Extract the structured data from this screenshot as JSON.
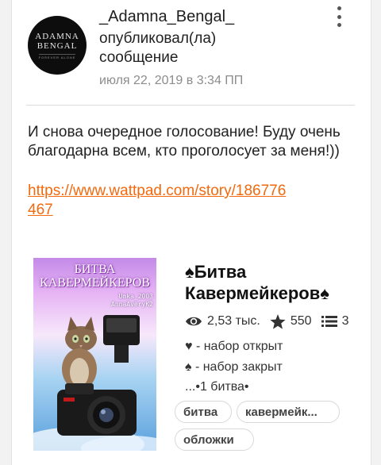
{
  "post": {
    "author": "_Adamna_Bengal_",
    "action": "опубликовал(ла) сообщение",
    "timestamp": "июля 22, 2019 в 3:34 ПП",
    "avatar": {
      "line1": "ADAMNA",
      "line2": "BENGAL",
      "line3": "FOREVER ALONE"
    },
    "menu_icon": "more-vertical-icon",
    "message": "И снова очередное голосование! Буду очень благодарна всем, кто проголосует за меня!))",
    "link": "https://www.wattpad.com/story/186776467"
  },
  "story": {
    "title": "♠Битва Кавермейкеров♠",
    "cover": {
      "title_line1": "БИТВА",
      "title_line2": "КАВЕРМЕЙКЕРОВ",
      "credit_line1": "Umka_2003",
      "credit_line2": "AnnaAveryK2"
    },
    "stats": {
      "reads": "2,53 тыс.",
      "votes": "550",
      "parts": "3"
    },
    "description": [
      "♥ - набор открыт",
      "♠ - набор закрыт",
      "...•1 битва•"
    ],
    "tags": [
      "битва",
      "кавермейк...",
      "обложки"
    ]
  },
  "colors": {
    "link": "#f2690e",
    "background": "#f2f2f2",
    "card": "#ffffff"
  }
}
